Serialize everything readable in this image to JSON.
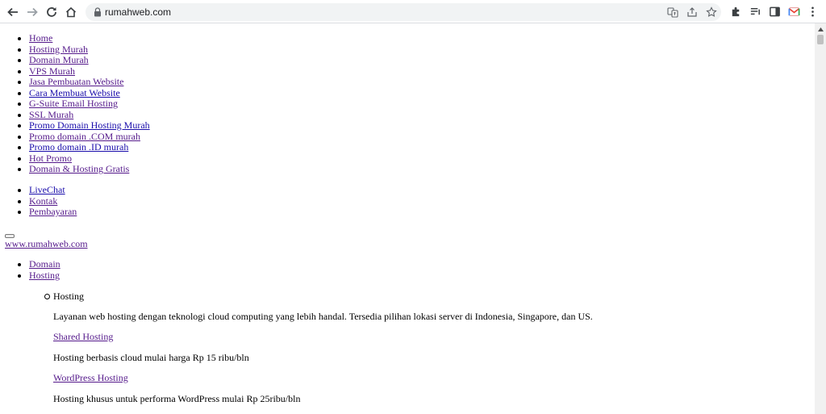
{
  "browser": {
    "url": "rumahweb.com"
  },
  "nav_top": [
    "Home",
    "Hosting Murah",
    "Domain Murah",
    "VPS Murah",
    "Jasa Pembuatan Website",
    "Cara Membuat Website",
    "G-Suite Email Hosting",
    "SSL Murah",
    "Promo Domain Hosting Murah",
    "Promo domain .COM murah",
    "Promo domain .ID murah",
    "Hot Promo",
    "Domain & Hosting Gratis"
  ],
  "nav_secondary": [
    "LiveChat",
    "Kontak",
    "Pembayaran"
  ],
  "site_link": "www.rumahweb.com",
  "main_menu": [
    "Domain",
    "Hosting"
  ],
  "hosting_submenu": {
    "heading": "Hosting",
    "description": "Layanan web hosting dengan teknologi cloud computing yang lebih handal. Tersedia pilihan lokasi server di Indonesia, Singapore, dan US.",
    "shared_link": "Shared Hosting",
    "shared_desc": "Hosting berbasis cloud mulai harga Rp 15 ribu/bln",
    "wordpress_link": "WordPress Hosting",
    "wordpress_desc": "Hosting khusus untuk performa WordPress mulai Rp 25ribu/bln"
  }
}
